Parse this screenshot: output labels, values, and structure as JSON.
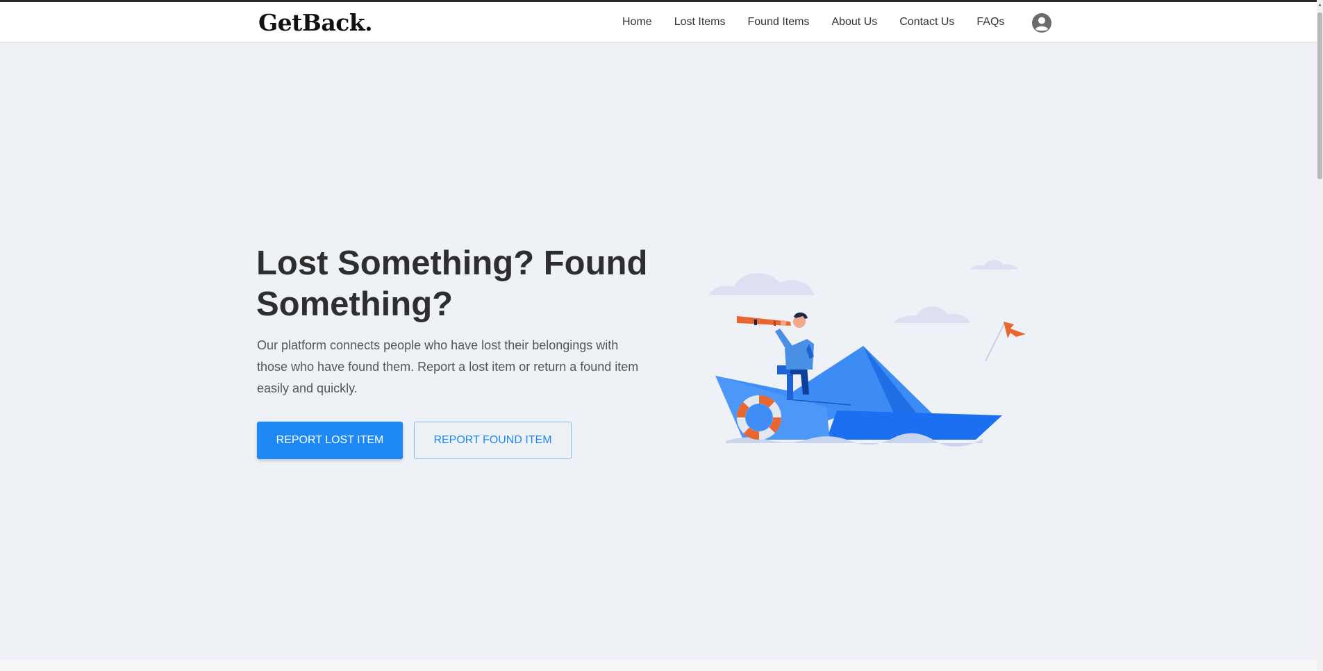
{
  "brand": {
    "logo": "GetBack."
  },
  "nav": {
    "items": [
      {
        "label": "Home"
      },
      {
        "label": "Lost Items"
      },
      {
        "label": "Found Items"
      },
      {
        "label": "About Us"
      },
      {
        "label": "Contact Us"
      },
      {
        "label": "FAQs"
      }
    ],
    "account_icon": "account-circle-icon"
  },
  "hero": {
    "title": "Lost Something? Found Something?",
    "description": "Our platform connects people who have lost their belongings with those who have found them. Report a lost item or return a found item easily and quickly.",
    "primary_button": "Report Lost Item",
    "secondary_button": "Report Found Item",
    "illustration": "man-with-telescope-on-paper-boat"
  },
  "colors": {
    "primary": "#1e88f5",
    "background": "#eef2f7",
    "title": "#2e2e2e",
    "accent_orange": "#e8662f"
  }
}
